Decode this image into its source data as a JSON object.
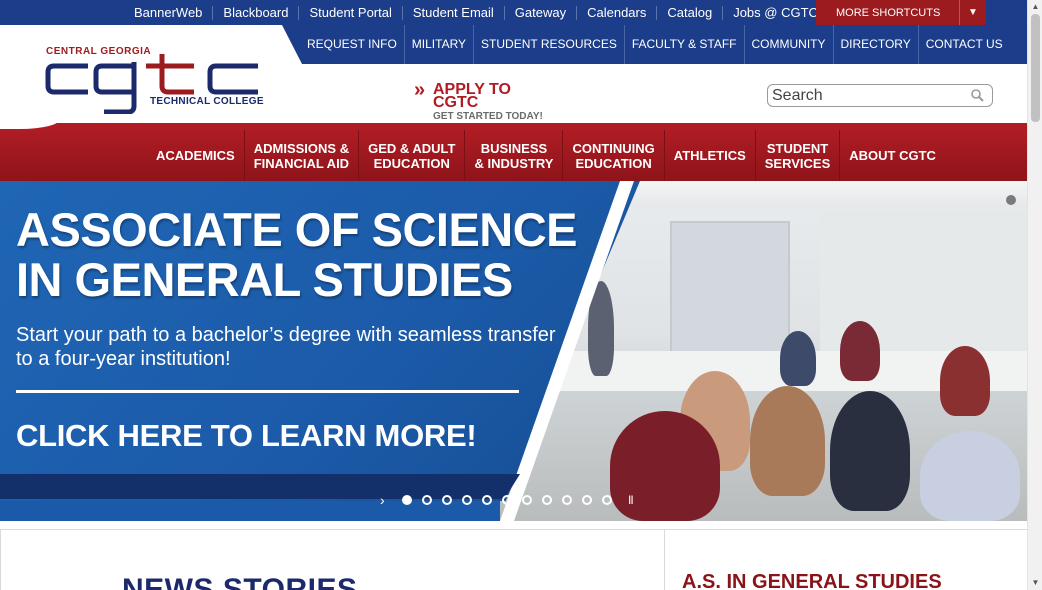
{
  "top_links": [
    "BannerWeb",
    "Blackboard",
    "Student Portal",
    "Student Email",
    "Gateway",
    "Calendars",
    "Catalog",
    "Jobs @ CGTC"
  ],
  "shortcuts": {
    "label": "MORE SHORTCUTS",
    "arrow": "▼"
  },
  "secondary_nav": [
    "REQUEST INFO",
    "MILITARY",
    "STUDENT RESOURCES",
    "FACULTY & STAFF",
    "COMMUNITY",
    "DIRECTORY",
    "CONTACT US"
  ],
  "logo": {
    "top": "CENTRAL GEORGIA",
    "mark": "cgtc",
    "bottom": "TECHNICAL COLLEGE"
  },
  "apply": {
    "chevron": "»",
    "title": "APPLY TO CGTC",
    "subtitle": "GET STARTED TODAY!"
  },
  "search": {
    "placeholder": "Search",
    "icon": "search-icon"
  },
  "main_nav": [
    "ACADEMICS",
    "ADMISSIONS &\nFINANCIAL AID",
    "GED & ADULT\nEDUCATION",
    "BUSINESS\n& INDUSTRY",
    "CONTINUING\nEDUCATION",
    "ATHLETICS",
    "STUDENT\nSERVICES",
    "ABOUT CGTC"
  ],
  "hero": {
    "headline_1": "ASSOCIATE OF SCIENCE",
    "headline_2": "IN GENERAL STUDIES",
    "subline": "Start your path to a bachelor’s degree with seamless transfer to a four-year institution!",
    "cta": "CLICK HERE TO LEARN MORE!",
    "slides": 11,
    "active_slide": 1,
    "next_glyph": "›",
    "pause_glyph": "II"
  },
  "content": {
    "news_title": "NEWS STORIES",
    "side_title": "A.S. IN GENERAL STUDIES"
  },
  "colors": {
    "navy": "#1c3d8a",
    "crimson": "#9c1b1f",
    "hero_blue": "#1b5aa8",
    "dark_navy": "#1c2a6b"
  },
  "scrollbar": {
    "up": "▲",
    "down": "▼"
  }
}
